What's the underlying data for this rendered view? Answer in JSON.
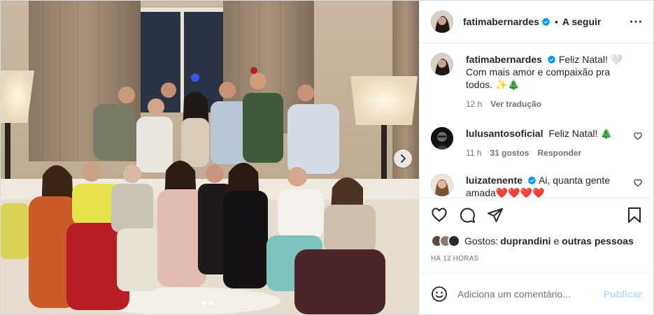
{
  "post": {
    "author": "fatimabernardes",
    "follow_label": "A seguir",
    "separator": "•",
    "caption": {
      "username": "fatimabernardes",
      "text": "Feliz Natal! 🤍 Com mais amor e compaixão pra todos. ✨🎄",
      "time": "12 h",
      "translate_label": "Ver tradução"
    },
    "comments": [
      {
        "username": "lulusantosoficial",
        "text": "Feliz Natal! 🎄",
        "time": "11 h",
        "likes": "31 gostos",
        "reply_label": "Responder"
      },
      {
        "username": "luizatenente",
        "text": "Ai, quanta gente amada❤️❤️❤️❤️"
      }
    ],
    "likes": {
      "prefix": "Gostos: ",
      "first_liker": "duprandini",
      "connector": " e ",
      "others": "outras pessoas"
    },
    "timestamp": "HÁ 12 HORAS",
    "add_comment": {
      "placeholder": "Adiciona um comentário...",
      "publish_label": "Publicar"
    },
    "carousel": {
      "slides": 2,
      "active": 1
    }
  },
  "colors": {
    "verified": "#0095f6",
    "publish_disabled": "#b2dffc",
    "secondary_text": "#737373",
    "primary_text": "#262626"
  },
  "icons": {
    "more": "more-horizontal-icon",
    "like": "heart-outline-icon",
    "comment": "speech-bubble-icon",
    "share": "paper-plane-icon",
    "save": "bookmark-icon",
    "emoji": "smiley-icon",
    "next": "chevron-right-icon",
    "verified": "verified-badge-icon"
  }
}
